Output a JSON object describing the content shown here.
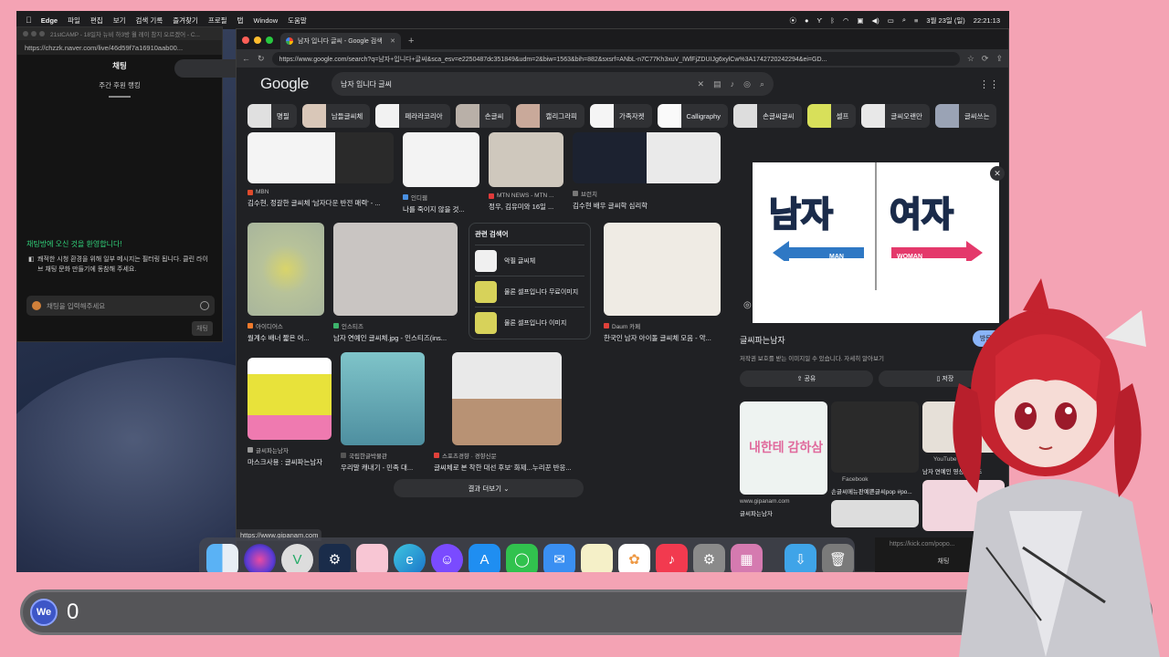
{
  "menubar": {
    "app": "Edge",
    "items": [
      "파일",
      "편집",
      "보기",
      "검색 기록",
      "즐겨찾기",
      "프로필",
      "탭",
      "Window",
      "도움말"
    ],
    "date": "3월 23일 (일)",
    "time": "22:21:13"
  },
  "chat_window": {
    "title_tab": "21stCAMP - 18일차 뉴비 하3방 월 레이 참지 오르겠어 - C...",
    "url": "https://chzzk.naver.com/live/46d59f7a16910aab00...",
    "header": "채팅",
    "tab": "주간 후원 랭킹",
    "welcome": "채팅방에 오신 것을 환영합니다!",
    "notice": "쾌적한 시청 환경을 위해 일부 메시지는 필터링 됩니다. 클린 라이브 채팅 문화 만들기에 동참해 주세요.",
    "input_placeholder": "채팅을 입력해주세요",
    "send_label": "채팅"
  },
  "browser": {
    "tab_title": "남자 입니다 글씨 - Google 검색",
    "url": "https://www.google.com/search?q=남자+입니다+글씨&sca_esv=e2250487dc351849&udm=2&biw=1563&bih=882&sxsrf=ANbL-n7C77Kh3xuV_IWlFjZDUIJg6xylCw%3A1742720242294&ei=GD...",
    "logo": "Google",
    "query": "남자 입니다 글씨",
    "chips": [
      "명필",
      "남들글씨체",
      "페라라코리아",
      "손글씨",
      "캘리그라피",
      "가족자켓",
      "Calligraphy",
      "손글씨글씨",
      "셀프",
      "글씨오랜만",
      "글씨쓰는"
    ],
    "results": [
      {
        "source": "MBN",
        "caption": "김수현, 정갈한 글씨체 '남자다운 반전 매력' - ..."
      },
      {
        "source": "인디웹",
        "caption": "나를 죽이지 않을 것..."
      },
      {
        "source": "MTN NEWS - MTN ...",
        "caption": "정우, 김유미와 16일 ..."
      },
      {
        "source": "브런치",
        "caption": "김수현 배우 글씨학 심리학"
      },
      {
        "source": "아이디어스",
        "caption": "월계수 배너 짧은 어..."
      },
      {
        "source": "인스티즈",
        "caption": "남자 연예인 글씨체.jpg - 인스티즈(ins..."
      },
      {
        "source": "Daum 카페",
        "caption": "한국인 남자 아이돌 글씨체 모음 - 악..."
      },
      {
        "source": "글씨파는남자",
        "caption": "마스크사용 : 글씨파는남자"
      },
      {
        "source": "국립한글박물관",
        "caption": "우리말 캐내기 - 민족 대..."
      },
      {
        "source": "스포츠경향 · 경향신문",
        "caption": "글씨체로 본 착한 대선 후보' 화제...누리꾼 반응..."
      }
    ],
    "related": {
      "title": "관련 검색어",
      "items": [
        "악필 글씨체",
        "물론 셀프입니다 무료이미지",
        "물론 셀프입니다 이미지"
      ]
    },
    "more_results": "결과 더보기",
    "status_url": "https://www.gipanam.com",
    "panel": {
      "image_text_left": "남자",
      "image_text_right": "여자",
      "man_label": "MAN",
      "woman_label": "WOMAN",
      "title": "글씨파는남자",
      "visit": "방문",
      "note": "저작권 보호를 받는 이미지일 수 있습니다. 자세히 알아보기",
      "share": "공유",
      "save": "저장",
      "similar": [
        {
          "source": "www.gipanam.com",
          "caption": "글씨파는남자",
          "img_text": "내한테 감하삼"
        },
        {
          "source": "Facebook",
          "caption": "손글씨메뉴판예쁜글씨pop #po..."
        },
        {
          "source": "YouTube",
          "caption": "남자 연예인 영상 시리즈"
        }
      ]
    }
  },
  "kick": {
    "url": "https://kick.com/popo...",
    "chat": "채팅"
  },
  "counter": {
    "badge": "We",
    "value": "0"
  },
  "colors": {
    "background": "#f4a3b4",
    "chzzk_green": "#31d17a",
    "google_dark": "#202124"
  }
}
